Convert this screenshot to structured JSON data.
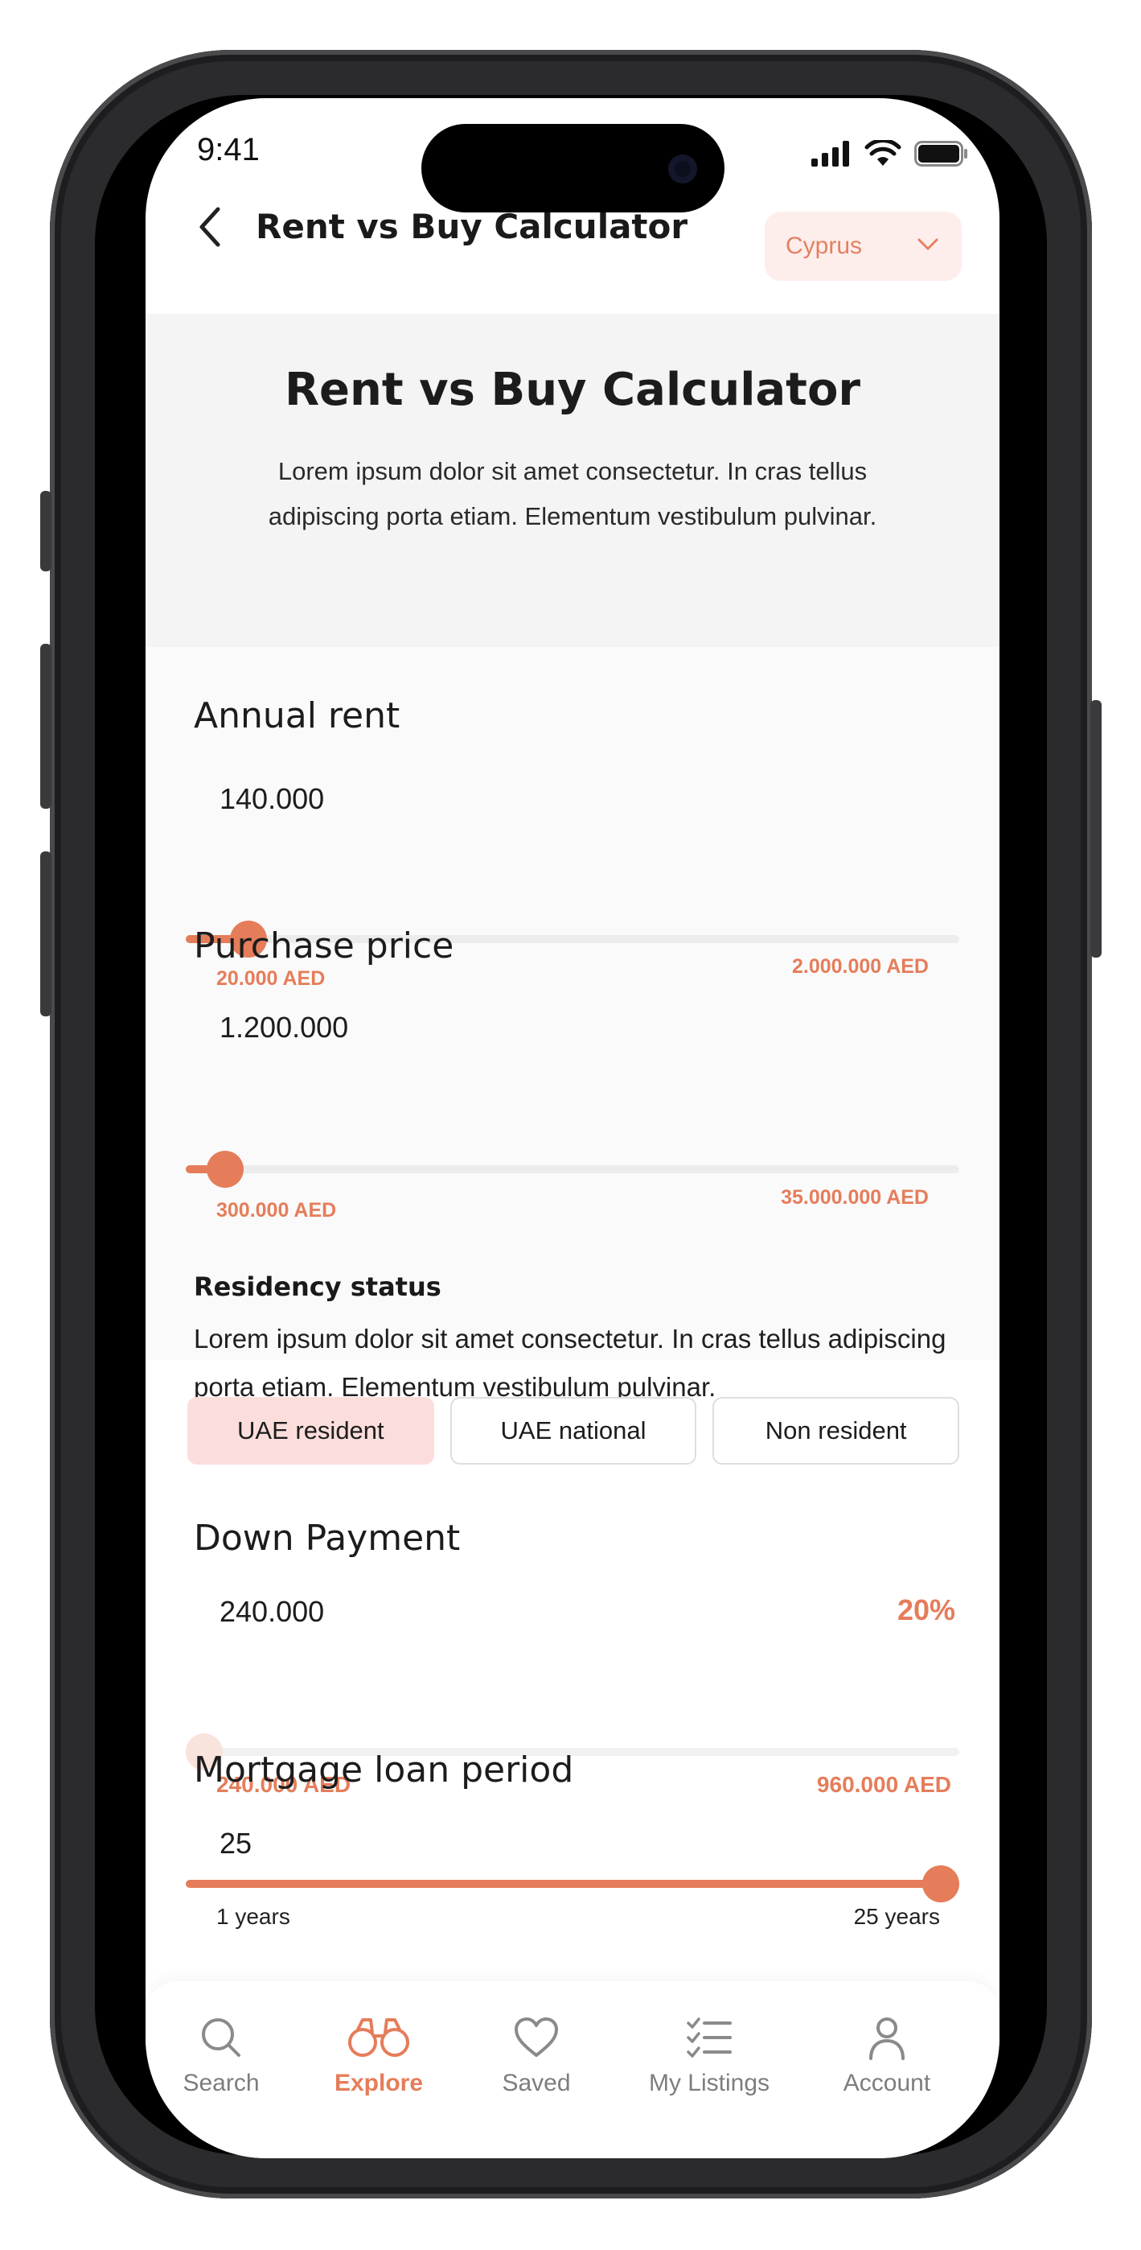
{
  "status_bar": {
    "time": "9:41"
  },
  "header": {
    "title": "Rent vs Buy Calculator",
    "country": "Cyprus"
  },
  "intro": {
    "title": "Rent vs Buy Calculator",
    "description": "Lorem ipsum dolor sit amet consectetur. In cras tellus adipiscing porta etiam. Elementum vestibulum pulvinar."
  },
  "annual_rent": {
    "label": "Annual rent",
    "value": "140.000",
    "min_label": "20.000 AED",
    "max_label": "2.000.000 AED",
    "slider_fraction": 0.06
  },
  "purchase_price": {
    "label": "Purchase price",
    "value": "1.200.000",
    "min_label": "300.000 AED",
    "max_label": "35.000.000 AED",
    "slider_fraction": 0.03
  },
  "residency": {
    "title": "Residency status",
    "description": "Lorem ipsum dolor sit amet consectetur. In cras tellus adipiscing porta etiam. Elementum vestibulum pulvinar.",
    "options": [
      "UAE resident",
      "UAE national",
      "Non resident"
    ],
    "selected": "UAE resident"
  },
  "down_payment": {
    "label": "Down Payment",
    "value": "240.000",
    "percent": "20%",
    "min_label": "240.000 AED",
    "max_label": "960.000 AED",
    "slider_fraction": 0.0
  },
  "mortgage_period": {
    "label": "Mortgage loan period",
    "value": "25",
    "min_label": "1 years",
    "max_label": "25 years",
    "slider_fraction": 1.0
  },
  "bottom_nav": {
    "items": [
      {
        "label": "Search",
        "icon": "search-icon"
      },
      {
        "label": "Explore",
        "icon": "binoculars-icon"
      },
      {
        "label": "Saved",
        "icon": "heart-icon"
      },
      {
        "label": "My Listings",
        "icon": "checklist-icon"
      },
      {
        "label": "Account",
        "icon": "user-icon"
      }
    ],
    "active": "Explore"
  },
  "colors": {
    "accent": "#e57d5a",
    "accent_light": "#fbdedb",
    "country_bg": "#fdeeec"
  }
}
